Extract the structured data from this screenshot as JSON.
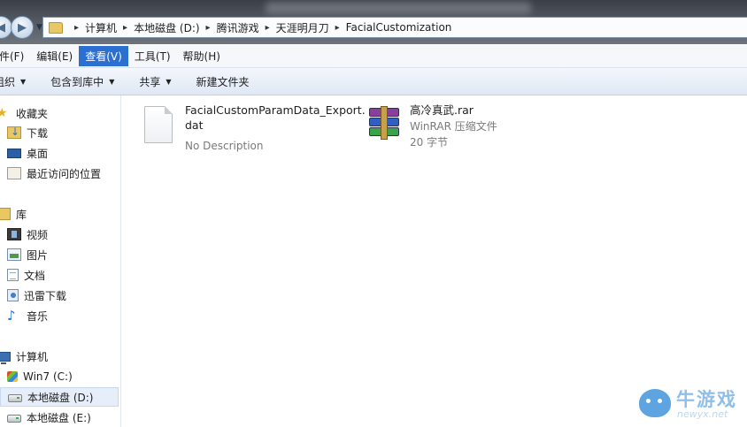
{
  "address_bar": {
    "breadcrumbs": [
      "计算机",
      "本地磁盘 (D:)",
      "腾讯游戏",
      "天涯明月刀",
      "FacialCustomization"
    ],
    "separator": "▸"
  },
  "menu": {
    "items": [
      "件(F)",
      "编辑(E)",
      "查看(V)",
      "工具(T)",
      "帮助(H)"
    ],
    "active_index": 2
  },
  "toolbar": {
    "organize": "组织",
    "include_library": "包含到库中",
    "share": "共享",
    "new_folder": "新建文件夹"
  },
  "sidebar": {
    "favorites": {
      "header": "收藏夹",
      "items": [
        "下载",
        "桌面",
        "最近访问的位置"
      ]
    },
    "libraries": {
      "header": "库",
      "items": [
        "视频",
        "图片",
        "文档",
        "迅雷下载",
        "音乐"
      ]
    },
    "computer": {
      "header": "计算机",
      "items": [
        "Win7 (C:)",
        "本地磁盘 (D:)",
        "本地磁盘 (E:)"
      ],
      "selected_index": 1
    }
  },
  "files": [
    {
      "name_line1": "FacialCustomParamData_Export.",
      "name_line2": "dat",
      "type_line": "No Description",
      "icon": "blank-file-icon"
    },
    {
      "name_line1": "高冷真武.rar",
      "type_line": "WinRAR 压缩文件",
      "size_line": "20 字节",
      "icon": "winrar-archive-icon"
    }
  ],
  "watermark": {
    "brand": "牛游戏",
    "domain": "newyx.net"
  },
  "colors": {
    "menu_active": "#2b6fd1",
    "sidebar_selected": "#e5eef9",
    "titlebar": "#4d535c"
  }
}
